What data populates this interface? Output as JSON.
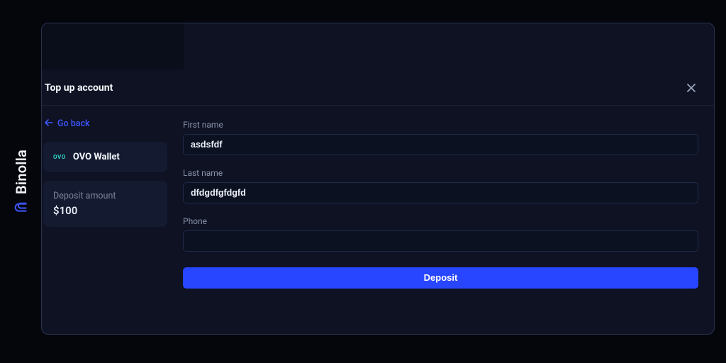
{
  "brand": {
    "name": "Binolla"
  },
  "modal": {
    "title": "Top up account",
    "go_back": "Go back",
    "wallet": {
      "badge": "OVO",
      "name": "OVO Wallet"
    },
    "deposit_amount_label": "Deposit amount",
    "deposit_amount_value": "$100",
    "form": {
      "first_name_label": "First name",
      "first_name_value": "asdsfdf",
      "last_name_label": "Last name",
      "last_name_value": "dfdgdfgfdgfd",
      "phone_label": "Phone",
      "phone_value": "",
      "deposit_button": "Deposit"
    }
  }
}
